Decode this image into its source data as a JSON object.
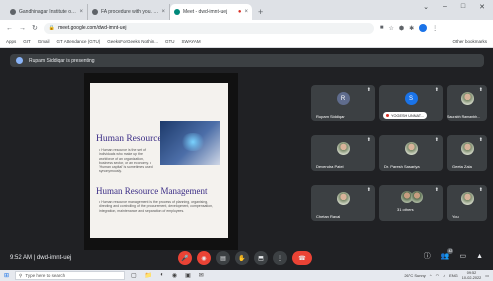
{
  "browser": {
    "tabs": [
      {
        "title": "Gandhinagar Institute of Technology",
        "fav_color": "#5f6368",
        "active": false
      },
      {
        "title": "FA procedure with you. 'CHR...",
        "fav_color": "#5f6368",
        "active": false
      },
      {
        "title": "Meet - dwd-imnt-uej",
        "fav_color": "#00897b",
        "active": true
      }
    ],
    "recording_dot": "●",
    "new_tab": "+",
    "url": "meet.google.com/dwd-imnt-uej",
    "bookmarks": [
      "Apps",
      "GIT",
      "Gmail",
      "GT Attendance (GTU)",
      "GeeksForGeeks Nothin...",
      "GTU",
      "SWAYAM",
      "Other bookmarks"
    ]
  },
  "meet": {
    "presenting_text": "Rupam Siddiqar is presenting",
    "slide": {
      "top_caption": "",
      "heading1": "Human Resource",
      "body1": "• Human resource is the set of individuals who make up the workforce of an organization, business sector, or an economy. • 'Human capital' is sometimes used synonymously.",
      "heading2": "Human Resource Management",
      "body2": "• Human resource management is the process of planning, organising, directing and controlling of the procurement, development, compensation, integration, maintenance and separation of employees."
    },
    "participants": [
      {
        "name": "Rupam Siddiqar",
        "kind": "letter",
        "initial": "R"
      },
      {
        "name": "YOGESH UNNAT...",
        "kind": "blue",
        "initial": "S",
        "chip": true
      },
      {
        "name": "Saurabh Ramanbh...",
        "kind": "photo"
      },
      {
        "name": "Devendra Patel",
        "kind": "photo"
      },
      {
        "name": "Dr. Paresh Sasariya",
        "kind": "photo"
      },
      {
        "name": "Geeta Zala",
        "kind": "photo"
      },
      {
        "name": "Chetan Raval",
        "kind": "photo"
      },
      {
        "name": "31 others",
        "kind": "group"
      },
      {
        "name": "You",
        "kind": "photo"
      }
    ],
    "clock_text": "9:52 AM  |  dwd-imnt-uej",
    "participant_count": "42"
  },
  "taskbar": {
    "search_placeholder": "Type here to search",
    "weather": "26°C Sunny",
    "lang": "ENG",
    "time": "09:52",
    "date": "10-02-2022"
  }
}
